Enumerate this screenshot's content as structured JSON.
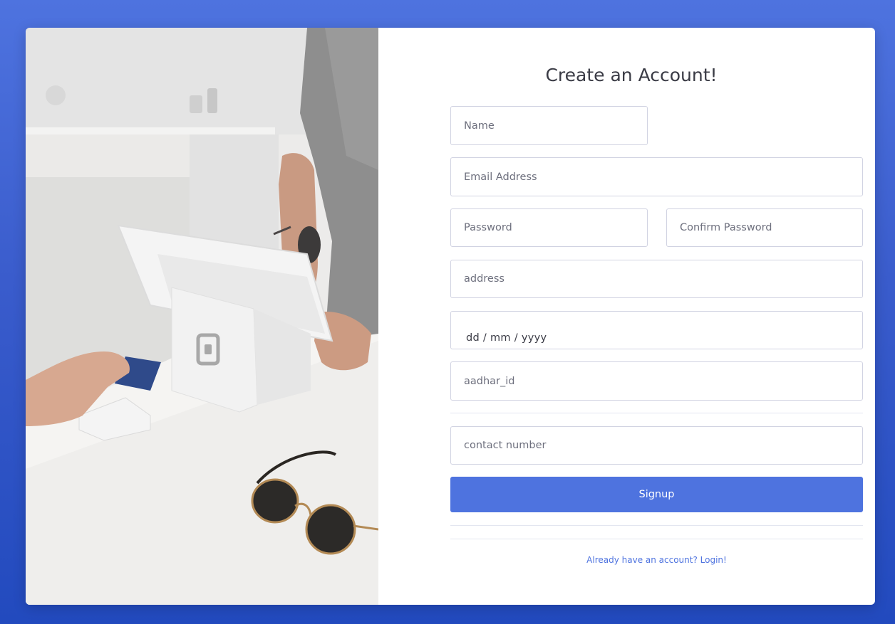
{
  "form": {
    "title": "Create an Account!",
    "name_placeholder": "Name",
    "email_placeholder": "Email Address",
    "password_placeholder": "Password",
    "confirm_password_placeholder": "Confirm Password",
    "address_placeholder": "address",
    "dob_placeholder": "dd / mm / yyyy",
    "aadhar_placeholder": "aadhar_id",
    "contact_placeholder": "contact number",
    "signup_label": "Signup",
    "login_link": "Already have an account? Login!"
  },
  "colors": {
    "accent": "#4e73df",
    "background_top": "#4e73df",
    "background_bottom": "#224abe",
    "text": "#3a3b45",
    "placeholder": "#6e707e",
    "border": "#d1d3e2"
  },
  "icons": {
    "terminal_logo": "square-logo-icon"
  }
}
